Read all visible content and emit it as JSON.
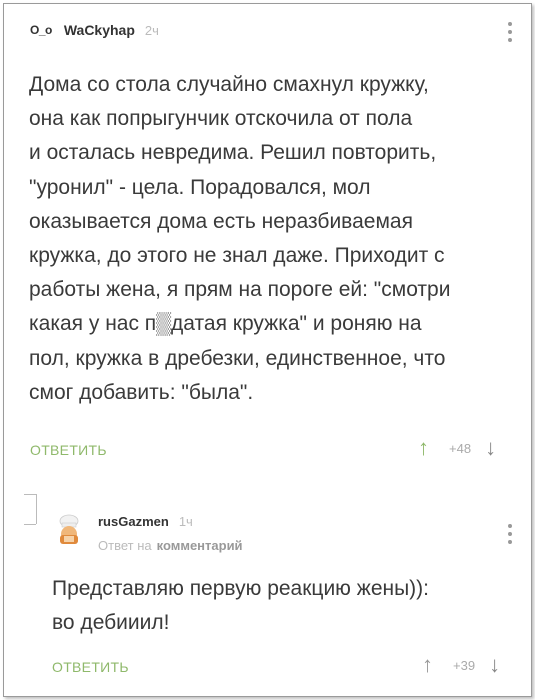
{
  "comment1": {
    "avatar_text": "O_o",
    "username": "WaCkyhap",
    "time": "2ч",
    "text": "Дома со стола случайно смахнул кружку,\nона как попрыгунчик отскочила от пола\nи осталась невредима. Решил повторить,\n\"уронил\" - цела. Порадовался, мол\nоказывается дома есть неразбиваемая\nкружка, до этого не знал даже. Приходит с\nработы жена, я прям на пороге ей: \"смотри\nкакая у нас п▒датая кружка\" и роняю на\nпол, кружка в дребезки, единственное, что\nсмог добавить: \"была\".",
    "reply_label": "ОТВЕТИТЬ",
    "score": "+48"
  },
  "comment2": {
    "username": "rusGazmen",
    "time": "1ч",
    "reply_prefix": "Ответ на",
    "reply_target": "комментарий",
    "text": "Представляю первую реакцию жены)):\nво дебииил!",
    "reply_label": "ОТВЕТИТЬ",
    "score": "+39"
  },
  "icons": {
    "upvote": "arrow-up-icon",
    "downvote": "arrow-down-icon",
    "more": "kebab-menu-icon",
    "avatar": "chef-avatar-icon"
  },
  "colors": {
    "accent": "#8fb96b",
    "muted": "#bbbbbb",
    "text": "#3a3a3a"
  }
}
